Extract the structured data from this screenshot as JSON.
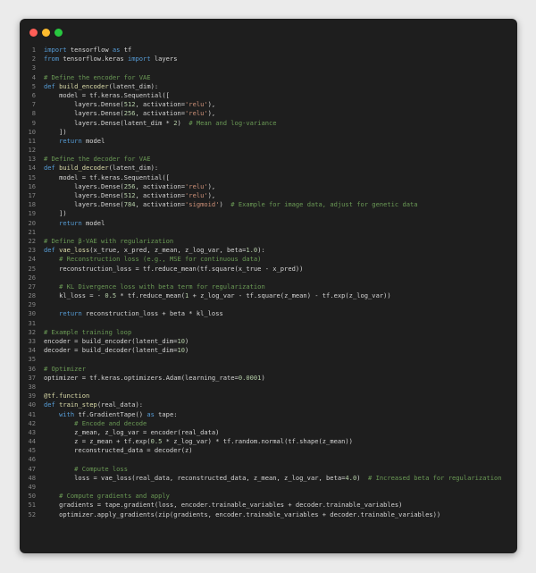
{
  "lines": [
    [
      [
        "kw",
        "import "
      ],
      [
        "pl",
        "tensorflow "
      ],
      [
        "kw",
        "as "
      ],
      [
        "pl",
        "tf"
      ]
    ],
    [
      [
        "kw",
        "from "
      ],
      [
        "pl",
        "tensorflow.keras "
      ],
      [
        "kw",
        "import "
      ],
      [
        "pl",
        "layers"
      ]
    ],
    [],
    [
      [
        "cm",
        "# Define the encoder for VAE"
      ]
    ],
    [
      [
        "kw",
        "def "
      ],
      [
        "fn",
        "build_encoder"
      ],
      [
        "pl",
        "(latent_dim):"
      ]
    ],
    [
      [
        "pl",
        "    model = tf.keras.Sequential(["
      ]
    ],
    [
      [
        "pl",
        "        layers.Dense("
      ],
      [
        "num",
        "512"
      ],
      [
        "pl",
        ", activation="
      ],
      [
        "str",
        "'relu'"
      ],
      [
        "pl",
        "),"
      ]
    ],
    [
      [
        "pl",
        "        layers.Dense("
      ],
      [
        "num",
        "256"
      ],
      [
        "pl",
        ", activation="
      ],
      [
        "str",
        "'relu'"
      ],
      [
        "pl",
        "),"
      ]
    ],
    [
      [
        "pl",
        "        layers.Dense(latent_dim * "
      ],
      [
        "num",
        "2"
      ],
      [
        "pl",
        ")  "
      ],
      [
        "cm",
        "# Mean and log-variance"
      ]
    ],
    [
      [
        "pl",
        "    ])"
      ]
    ],
    [
      [
        "pl",
        "    "
      ],
      [
        "kw",
        "return "
      ],
      [
        "pl",
        "model"
      ]
    ],
    [],
    [
      [
        "cm",
        "# Define the decoder for VAE"
      ]
    ],
    [
      [
        "kw",
        "def "
      ],
      [
        "fn",
        "build_decoder"
      ],
      [
        "pl",
        "(latent_dim):"
      ]
    ],
    [
      [
        "pl",
        "    model = tf.keras.Sequential(["
      ]
    ],
    [
      [
        "pl",
        "        layers.Dense("
      ],
      [
        "num",
        "256"
      ],
      [
        "pl",
        ", activation="
      ],
      [
        "str",
        "'relu'"
      ],
      [
        "pl",
        "),"
      ]
    ],
    [
      [
        "pl",
        "        layers.Dense("
      ],
      [
        "num",
        "512"
      ],
      [
        "pl",
        ", activation="
      ],
      [
        "str",
        "'relu'"
      ],
      [
        "pl",
        "),"
      ]
    ],
    [
      [
        "pl",
        "        layers.Dense("
      ],
      [
        "num",
        "784"
      ],
      [
        "pl",
        ", activation="
      ],
      [
        "str",
        "'sigmoid'"
      ],
      [
        "pl",
        ")  "
      ],
      [
        "cm",
        "# Example for image data, adjust for genetic data"
      ]
    ],
    [
      [
        "pl",
        "    ])"
      ]
    ],
    [
      [
        "pl",
        "    "
      ],
      [
        "kw",
        "return "
      ],
      [
        "pl",
        "model"
      ]
    ],
    [],
    [
      [
        "cm",
        "# Define β-VAE with regularization"
      ]
    ],
    [
      [
        "kw",
        "def "
      ],
      [
        "fn",
        "vae_loss"
      ],
      [
        "pl",
        "(x_true, x_pred, z_mean, z_log_var, beta="
      ],
      [
        "num",
        "1.0"
      ],
      [
        "pl",
        "):"
      ]
    ],
    [
      [
        "pl",
        "    "
      ],
      [
        "cm",
        "# Reconstruction loss (e.g., MSE for continuous data)"
      ]
    ],
    [
      [
        "pl",
        "    reconstruction_loss = tf.reduce_mean(tf.square(x_true - x_pred))"
      ]
    ],
    [],
    [
      [
        "pl",
        "    "
      ],
      [
        "cm",
        "# KL Divergence loss with beta term for regularization"
      ]
    ],
    [
      [
        "pl",
        "    kl_loss = - "
      ],
      [
        "num",
        "0.5"
      ],
      [
        "pl",
        " * tf.reduce_mean("
      ],
      [
        "num",
        "1"
      ],
      [
        "pl",
        " + z_log_var - tf.square(z_mean) - tf.exp(z_log_var))"
      ]
    ],
    [],
    [
      [
        "pl",
        "    "
      ],
      [
        "kw",
        "return "
      ],
      [
        "pl",
        "reconstruction_loss + beta * kl_loss"
      ]
    ],
    [],
    [
      [
        "cm",
        "# Example training loop"
      ]
    ],
    [
      [
        "pl",
        "encoder = build_encoder(latent_dim="
      ],
      [
        "num",
        "10"
      ],
      [
        "pl",
        ")"
      ]
    ],
    [
      [
        "pl",
        "decoder = build_decoder(latent_dim="
      ],
      [
        "num",
        "10"
      ],
      [
        "pl",
        ")"
      ]
    ],
    [],
    [
      [
        "cm",
        "# Optimizer"
      ]
    ],
    [
      [
        "pl",
        "optimizer = tf.keras.optimizers.Adam(learning_rate="
      ],
      [
        "num",
        "0.0001"
      ],
      [
        "pl",
        ")"
      ]
    ],
    [],
    [
      [
        "fn",
        "@tf.function"
      ]
    ],
    [
      [
        "kw",
        "def "
      ],
      [
        "fn",
        "train_step"
      ],
      [
        "pl",
        "(real_data):"
      ]
    ],
    [
      [
        "pl",
        "    "
      ],
      [
        "kw",
        "with "
      ],
      [
        "pl",
        "tf.GradientTape() "
      ],
      [
        "kw",
        "as "
      ],
      [
        "pl",
        "tape:"
      ]
    ],
    [
      [
        "pl",
        "        "
      ],
      [
        "cm",
        "# Encode and decode"
      ]
    ],
    [
      [
        "pl",
        "        z_mean, z_log_var = encoder(real_data)"
      ]
    ],
    [
      [
        "pl",
        "        z = z_mean + tf.exp("
      ],
      [
        "num",
        "0.5"
      ],
      [
        "pl",
        " * z_log_var) * tf.random.normal(tf.shape(z_mean))"
      ]
    ],
    [
      [
        "pl",
        "        reconstructed_data = decoder(z)"
      ]
    ],
    [],
    [
      [
        "pl",
        "        "
      ],
      [
        "cm",
        "# Compute loss"
      ]
    ],
    [
      [
        "pl",
        "        loss = vae_loss(real_data, reconstructed_data, z_mean, z_log_var, beta="
      ],
      [
        "num",
        "4.0"
      ],
      [
        "pl",
        ")  "
      ],
      [
        "cm",
        "# Increased beta for regularization"
      ]
    ],
    [],
    [
      [
        "pl",
        "    "
      ],
      [
        "cm",
        "# Compute gradients and apply"
      ]
    ],
    [
      [
        "pl",
        "    gradients = tape.gradient(loss, encoder.trainable_variables + decoder.trainable_variables)"
      ]
    ],
    [
      [
        "pl",
        "    optimizer.apply_gradients(zip(gradients, encoder.trainable_variables + decoder.trainable_variables))"
      ]
    ]
  ]
}
